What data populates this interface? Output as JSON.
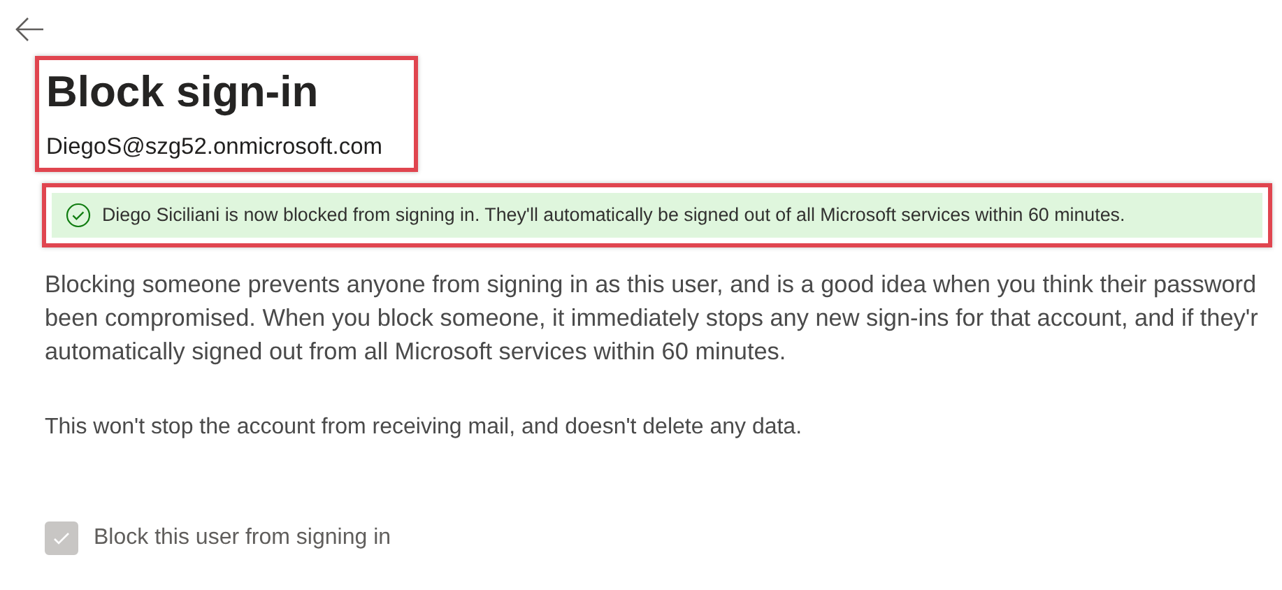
{
  "title": "Block sign-in",
  "email": "DiegoS@szg52.onmicrosoft.com",
  "notice": {
    "kind": "success",
    "text": "Diego Siciliani is now blocked from signing in. They'll automatically be signed out of all Microsoft services within 60 minutes."
  },
  "description_lines": [
    "Blocking someone prevents anyone from signing in as this user, and is a good idea when you think their password",
    "been compromised. When you block someone, it immediately stops any new sign-ins for that account, and if they'r",
    "automatically signed out from all Microsoft services within 60 minutes."
  ],
  "note": "This won't stop the account from receiving mail, and doesn't delete any data.",
  "checkbox": {
    "label": "Block this user from signing in",
    "checked": true,
    "disabled": true
  }
}
